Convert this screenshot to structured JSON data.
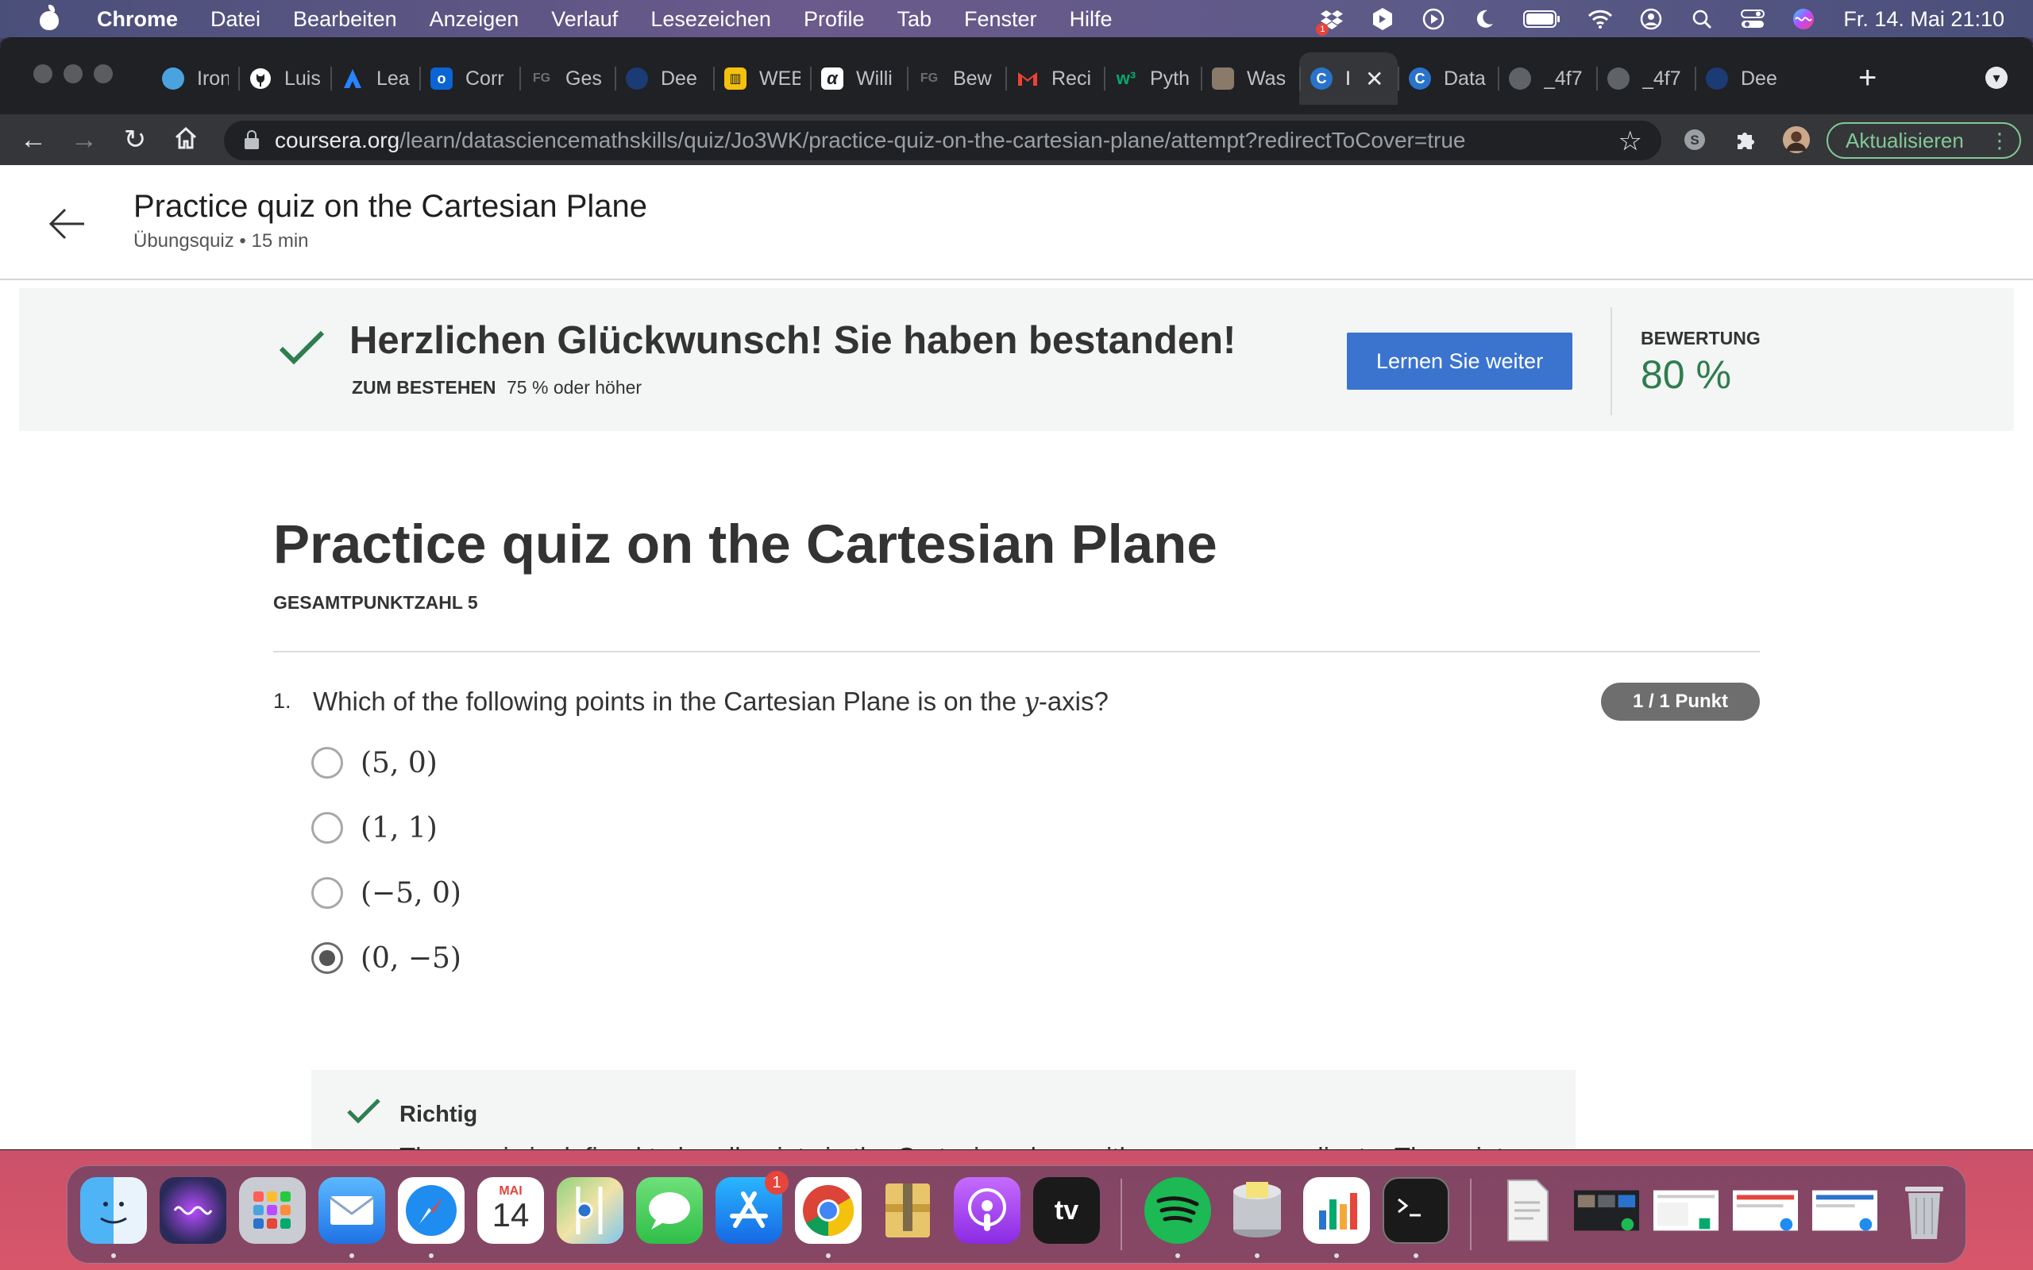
{
  "menubar": {
    "app_name": "Chrome",
    "items": [
      "Datei",
      "Bearbeiten",
      "Anzeigen",
      "Verlauf",
      "Lesezeichen",
      "Profile",
      "Tab",
      "Fenster",
      "Hilfe"
    ],
    "clock": "Fr. 14. Mai  21:10",
    "status_icons": [
      "dropbox-icon",
      "cube-app-icon",
      "play-circle-icon",
      "moon-icon",
      "battery-icon",
      "wifi-icon",
      "user-circle-icon",
      "spotlight-search-icon",
      "control-center-icon",
      "siri-icon"
    ],
    "dropbox_badge": "1"
  },
  "browser": {
    "tabs": [
      {
        "label": "Iron",
        "icon": "ironhack-favicon",
        "color": "#4aa3df"
      },
      {
        "label": "Luis",
        "icon": "github-favicon",
        "color": "#ffffff"
      },
      {
        "label": "Lear",
        "icon": "atlassian-favicon",
        "color": "#2684ff"
      },
      {
        "label": "Corr",
        "icon": "outlook-favicon",
        "color": "#0a64d2"
      },
      {
        "label": "Ges",
        "icon": "fg-favicon",
        "color": "#555a60"
      },
      {
        "label": "Dee",
        "icon": "globe-favicon",
        "color": "#1b3b75"
      },
      {
        "label": "WEB",
        "icon": "bank-favicon",
        "color": "#f4c20d"
      },
      {
        "label": "Willi",
        "icon": "alpha-favicon",
        "color": "#ffffff"
      },
      {
        "label": "Bew",
        "icon": "fg-favicon",
        "color": "#555a60"
      },
      {
        "label": "Reci",
        "icon": "gmail-favicon",
        "color": "#ea4335"
      },
      {
        "label": "Pyth",
        "icon": "w3-favicon",
        "color": "#04aa6d"
      },
      {
        "label": "Was",
        "icon": "image-favicon",
        "color": "#8a7a6a"
      },
      {
        "label": "I",
        "icon": "coursera-favicon",
        "color": "#2a73cc",
        "active": true
      },
      {
        "label": "Data",
        "icon": "coursera-favicon",
        "color": "#2a73cc"
      },
      {
        "label": "_4f7",
        "icon": "globe-favicon",
        "color": "#5f6368"
      },
      {
        "label": "_4f7",
        "icon": "globe-favicon",
        "color": "#5f6368"
      },
      {
        "label": "Dee",
        "icon": "globe-favicon",
        "color": "#1b3b75"
      }
    ],
    "url_domain": "coursera.org",
    "url_path": "/learn/datasciencemathskills/quiz/Jo3WK/practice-quiz-on-the-cartesian-plane/attempt?redirectToCover=true",
    "update_label": "Aktualisieren"
  },
  "page": {
    "header": {
      "title": "Practice quiz on the Cartesian Plane",
      "subtitle": "Übungsquiz • 15 min"
    },
    "banner": {
      "title": "Herzlichen Glückwunsch! Sie haben bestanden!",
      "pass_label": "ZUM BESTEHEN",
      "pass_value": "75 % oder höher",
      "continue_label": "Lernen Sie weiter",
      "grade_label": "BEWERTUNG",
      "grade_value": "80 %"
    },
    "quiz": {
      "title": "Practice quiz on the Cartesian Plane",
      "total_points": "GESAMTPUNKTZAHL 5",
      "question": {
        "number": "1.",
        "text_before": "Which of the following points in the Cartesian Plane is on the ",
        "text_var": "y",
        "text_after": "-axis?",
        "score": "1 / 1 Punkt",
        "options": [
          {
            "label": "(5, 0)",
            "selected": false
          },
          {
            "label": "(1, 1)",
            "selected": false
          },
          {
            "label": "(−5, 0)",
            "selected": false
          },
          {
            "label": "(0, −5)",
            "selected": true
          }
        ],
        "feedback": {
          "title": "Richtig",
          "t1": "The ",
          "v1": "y",
          "t2": "-axis is defined to be all points in the Cartesian plane with zero as ",
          "v2": "x",
          "t3": "-coordinate. The point"
        }
      }
    }
  },
  "dock": {
    "apps": [
      "finder",
      "siri",
      "launchpad",
      "mail",
      "safari",
      "calendar",
      "maps",
      "messages",
      "app-store",
      "chrome",
      "archive-utility",
      "podcasts",
      "apple-tv",
      "spotify",
      "sequel-pro",
      "numbers",
      "terminal"
    ],
    "calendar_month": "MAI",
    "calendar_day": "14",
    "app_store_badge": "1",
    "tv_label": "tv",
    "colors": {
      "accent": "#3b74cf",
      "success": "#2e7d4f"
    }
  }
}
